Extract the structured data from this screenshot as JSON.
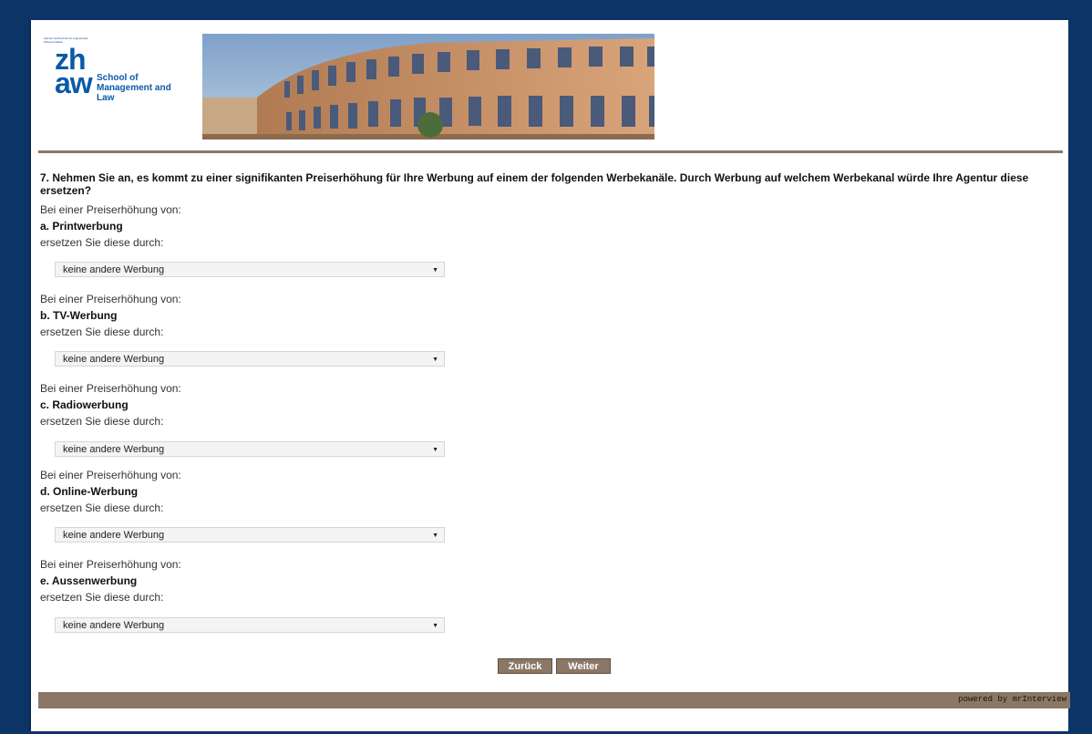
{
  "logo": {
    "fine_print": "Zürcher Hochschule für Angewandte Wissenschaften",
    "brand": "zh aw",
    "brand_line1": "zh",
    "brand_line2": "aw",
    "school_line1": "School of",
    "school_line2": "Management and Law"
  },
  "question": "7. Nehmen Sie an, es kommt zu einer signifikanten Preiserhöhung für Ihre Werbung auf einem der folgenden Werbekanäle. Durch Werbung auf welchem Werbekanal würde Ihre Agentur diese ersetzen?",
  "items": [
    {
      "intro": "Bei einer Preiserhöhung von:",
      "label": "a. Printwerbung",
      "replace": "ersetzen Sie diese durch:",
      "selected": "keine andere Werbung"
    },
    {
      "intro": "Bei einer Preiserhöhung von:",
      "label": "b. TV-Werbung",
      "replace": "ersetzen Sie diese durch:",
      "selected": "keine andere Werbung"
    },
    {
      "intro": "Bei einer Preiserhöhung von:",
      "label": "c. Radiowerbung",
      "replace": "ersetzen Sie diese durch:",
      "selected": "keine andere Werbung"
    },
    {
      "intro": "Bei einer Preiserhöhung von:",
      "label": "d. Online-Werbung",
      "replace": "ersetzen Sie diese durch:",
      "selected": "keine andere Werbung"
    },
    {
      "intro": "Bei einer Preiserhöhung von:",
      "label": "e. Aussenwerbung",
      "replace": "ersetzen Sie diese durch:",
      "selected": "keine andere Werbung"
    }
  ],
  "buttons": {
    "back": "Zurück",
    "next": "Weiter"
  },
  "footer": {
    "powered": "powered by mrInterview"
  },
  "colors": {
    "frame": "#0d3466",
    "accent": "#8a7766",
    "brand_blue": "#0b5aa8"
  }
}
